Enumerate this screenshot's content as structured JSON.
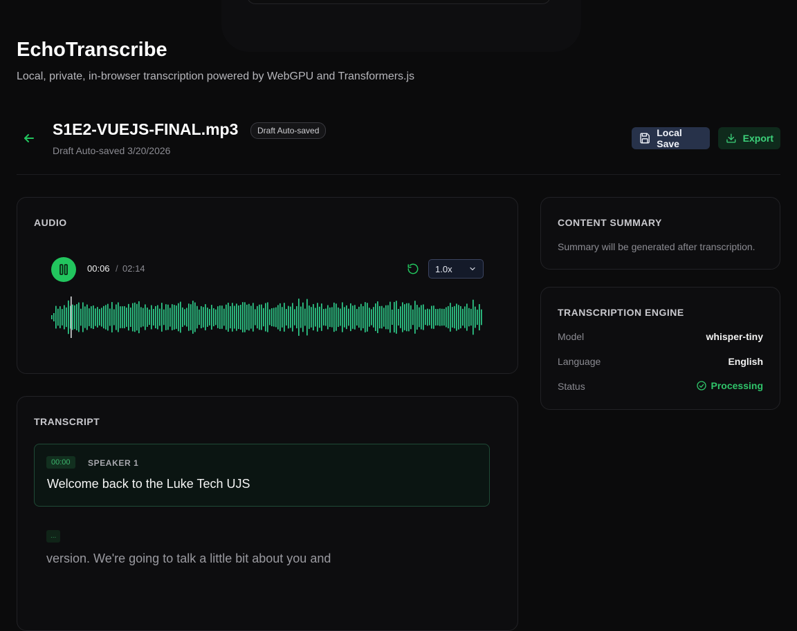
{
  "app": {
    "title": "EchoTranscribe",
    "subtitle": "Local, private, in-browser transcription powered by WebGPU and Transformers.js"
  },
  "file": {
    "name": "S1E2-VUEJS-FINAL.mp3",
    "badge": "Draft Auto-saved",
    "meta": "Draft Auto-saved 3/20/2026"
  },
  "actions": {
    "save_label": "Local Save",
    "export_label": "Export"
  },
  "audio": {
    "heading": "AUDIO",
    "current_time": "00:06",
    "separator": "/",
    "duration": "02:14",
    "speed": "1.0x",
    "playing": true,
    "progress": 0.045
  },
  "transcript": {
    "heading": "TRANSCRIPT",
    "segments": [
      {
        "time": "00:00",
        "speaker": "SPEAKER 1",
        "text": "Welcome back to the Luke Tech UJS"
      },
      {
        "time": "...",
        "speaker": "",
        "text": "version. We're going to talk a little bit about you and"
      }
    ]
  },
  "summary": {
    "heading": "CONTENT SUMMARY",
    "text": "Summary will be generated after transcription."
  },
  "engine": {
    "heading": "TRANSCRIPTION ENGINE",
    "rows": [
      {
        "label": "Model",
        "value": "whisper-tiny"
      },
      {
        "label": "Language",
        "value": "English"
      },
      {
        "label": "Status",
        "value": "Processing"
      }
    ]
  },
  "colors": {
    "accent": "#22c55e",
    "background": "#0b0b0c",
    "waveform": "#2ecc8a"
  },
  "icons": {
    "back": "arrow-left-icon",
    "save": "floppy-disk-icon",
    "export": "download-icon",
    "play_state": "pause-icon",
    "loop": "rotate-ccw-icon",
    "speed_dropdown": "chevron-down-icon",
    "status": "check-circle-icon"
  }
}
